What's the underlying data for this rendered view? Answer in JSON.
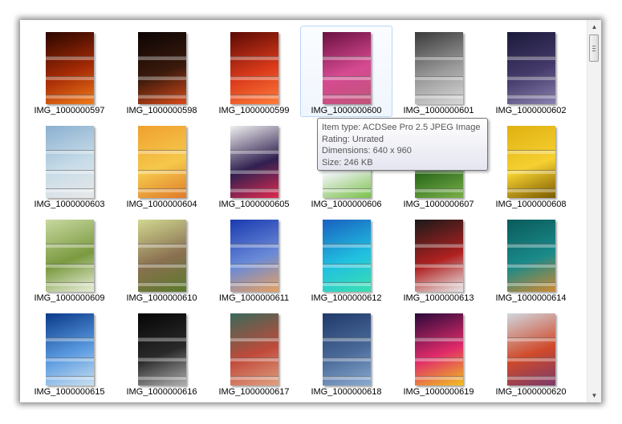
{
  "window": {
    "scrollbar": {
      "up_glyph": "▲",
      "down_glyph": "▼"
    }
  },
  "files": [
    {
      "name": "IMG_1000000597",
      "palette": [
        "#2a0600",
        "#a52a05",
        "#f07a1a"
      ],
      "selected": false
    },
    {
      "name": "IMG_1000000598",
      "palette": [
        "#0c0404",
        "#3a1a0c",
        "#d94a1a"
      ],
      "selected": false
    },
    {
      "name": "IMG_1000000599",
      "palette": [
        "#5a0a04",
        "#d9391a",
        "#ff7c3a"
      ],
      "selected": false
    },
    {
      "name": "IMG_1000000600",
      "palette": [
        "#6a1040",
        "#d64a92",
        "#c0557a"
      ],
      "selected": true
    },
    {
      "name": "IMG_1000000601",
      "palette": [
        "#3a3a3a",
        "#9a9a9a",
        "#d8d8d8"
      ],
      "selected": false
    },
    {
      "name": "IMG_1000000602",
      "palette": [
        "#1a1a3a",
        "#453a6a",
        "#8a82b0"
      ],
      "selected": false
    },
    {
      "name": "IMG_1000000603",
      "palette": [
        "#8ab0d0",
        "#c8dce8",
        "#e8e8e8"
      ],
      "selected": false
    },
    {
      "name": "IMG_1000000604",
      "palette": [
        "#f0a030",
        "#f5c84a",
        "#e07a2a"
      ],
      "selected": false
    },
    {
      "name": "IMG_1000000605",
      "palette": [
        "#f0f0f0",
        "#302050",
        "#e02a50"
      ],
      "selected": false
    },
    {
      "name": "IMG_1000000606",
      "palette": [
        "#d0e8f0",
        "#f0f4f6",
        "#7ac04a"
      ],
      "selected": false
    },
    {
      "name": "IMG_1000000607",
      "palette": [
        "#0a2a10",
        "#2a6a1a",
        "#7ab04a"
      ],
      "selected": false
    },
    {
      "name": "IMG_1000000608",
      "palette": [
        "#e0b010",
        "#f5d030",
        "#7a5a00"
      ],
      "selected": false
    },
    {
      "name": "IMG_1000000609",
      "palette": [
        "#c8d8a0",
        "#7a9a40",
        "#e8eed8"
      ],
      "selected": false
    },
    {
      "name": "IMG_1000000610",
      "palette": [
        "#d0d890",
        "#8a7050",
        "#5a7a2a"
      ],
      "selected": false
    },
    {
      "name": "IMG_1000000611",
      "palette": [
        "#1a3ab0",
        "#6a8ad8",
        "#e8a060"
      ],
      "selected": false
    },
    {
      "name": "IMG_1000000612",
      "palette": [
        "#1a60c0",
        "#20c0e0",
        "#3ae0b0"
      ],
      "selected": false
    },
    {
      "name": "IMG_1000000613",
      "palette": [
        "#1a1a1a",
        "#b02020",
        "#e8e8e8"
      ],
      "selected": false
    },
    {
      "name": "IMG_1000000614",
      "palette": [
        "#0a5a5a",
        "#1a8a8a",
        "#d08a30"
      ],
      "selected": false
    },
    {
      "name": "IMG_1000000615",
      "palette": [
        "#0a3a8a",
        "#5a9ae0",
        "#c8e0f0"
      ],
      "selected": false
    },
    {
      "name": "IMG_1000000616",
      "palette": [
        "#050505",
        "#2a2a2a",
        "#b0b0b0"
      ],
      "selected": false
    },
    {
      "name": "IMG_1000000617",
      "palette": [
        "#3a6a5a",
        "#c04a3a",
        "#e0a080"
      ],
      "selected": false
    },
    {
      "name": "IMG_1000000618",
      "palette": [
        "#203a6a",
        "#4a6a9a",
        "#8aaad0"
      ],
      "selected": false
    },
    {
      "name": "IMG_1000000619",
      "palette": [
        "#2a0a3a",
        "#e02a6a",
        "#f0c020"
      ],
      "selected": false
    },
    {
      "name": "IMG_1000000620",
      "palette": [
        "#d0d8e0",
        "#d04a2a",
        "#7a3a6a"
      ],
      "selected": false
    }
  ],
  "tooltip": {
    "item_type": "Item type: ACDSee Pro 2.5 JPEG Image",
    "rating": "Rating: Unrated",
    "dimensions": "Dimensions: 640 x 960",
    "size": "Size: 246 KB"
  }
}
